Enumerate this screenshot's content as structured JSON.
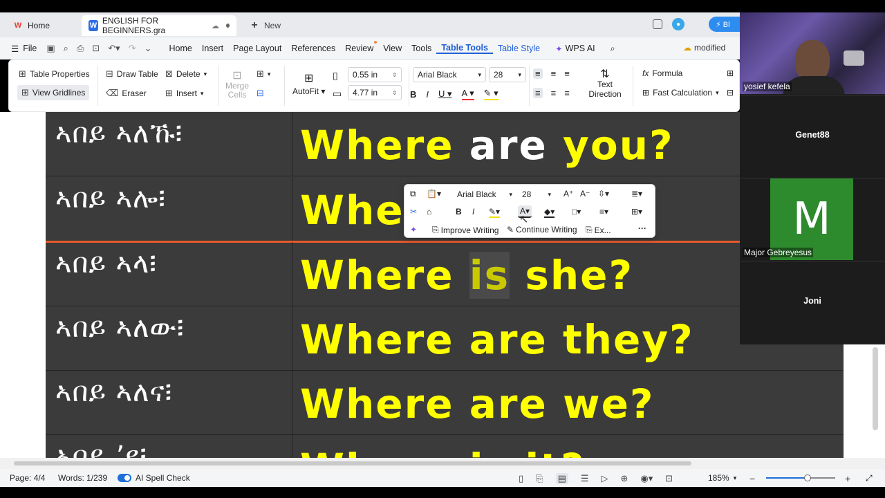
{
  "tabs": {
    "home": "Home",
    "doc": "ENGLISH FOR BEGINNERS.gra",
    "new": "New"
  },
  "menu": {
    "file": "File",
    "items": [
      "Home",
      "Insert",
      "Page Layout",
      "References",
      "Review",
      "View",
      "Tools"
    ],
    "table_tools": "Table Tools",
    "table_style": "Table Style",
    "wps_ai": "WPS AI",
    "modified": "modified"
  },
  "ribbon": {
    "table_properties": "Table Properties",
    "view_gridlines": "View Gridlines",
    "draw_table": "Draw Table",
    "eraser": "Eraser",
    "delete": "Delete",
    "insert": "Insert",
    "merge_cells": "Merge Cells",
    "autofit": "AutoFit",
    "height": "0.55 in",
    "width": "4.77 in",
    "font": "Arial Black",
    "size": "28",
    "text_direction": "Text Direction",
    "formula": "Formula",
    "fast_calc": "Fast Calculation"
  },
  "table": {
    "rows": [
      {
        "tig": "ኣበይ  ኣለኹ፧",
        "eng_parts": [
          "Where ",
          "are",
          " you?"
        ]
      },
      {
        "tig": "ኣበይ  ኣሎ፧",
        "eng": "Whe"
      },
      {
        "tig": "ኣበይ  ኣላ፧",
        "eng_parts": [
          "Where ",
          "is",
          " she?"
        ]
      },
      {
        "tig": "ኣበይ  ኣለው፧",
        "eng": "Where are they?"
      },
      {
        "tig": "ኣበይ  ኣለና፧",
        "eng": "Where are we?"
      },
      {
        "tig": "ኣበይ ’ዩ፧",
        "eng": "Where is it?"
      }
    ]
  },
  "mini_toolbar": {
    "font": "Arial Black",
    "size": "28",
    "improve": "Improve Writing",
    "continue": "Continue Writing",
    "extra": "Ex..."
  },
  "status": {
    "page": "Page: 4/4",
    "words": "Words: 1/239",
    "spell": "AI Spell Check",
    "zoom": "185%",
    "zoom_fraction": 0.6
  },
  "participants": [
    {
      "name": "yosief kefela"
    },
    {
      "name": "Genet88"
    },
    {
      "name": "Major Gebreyesus",
      "initial": "M"
    },
    {
      "name": "Joni"
    }
  ],
  "colors": {
    "accent": "#1e5fd6",
    "highlight_text": "#ffff00",
    "table_bg": "#3b3b3b",
    "red_line": "#e8592a",
    "avatar_green": "#2d8a2d"
  },
  "icons": [
    "wps-logo-icon",
    "word-doc-icon",
    "cloud-icon",
    "plus-icon",
    "menu-icon",
    "save-icon",
    "print-icon",
    "undo-icon",
    "redo-icon",
    "search-icon",
    "sparkle-icon",
    "formula-icon",
    "bold-icon",
    "italic-icon",
    "underline-icon",
    "font-color-icon",
    "highlight-icon",
    "copy-icon",
    "cut-icon",
    "paste-icon",
    "more-icon"
  ]
}
